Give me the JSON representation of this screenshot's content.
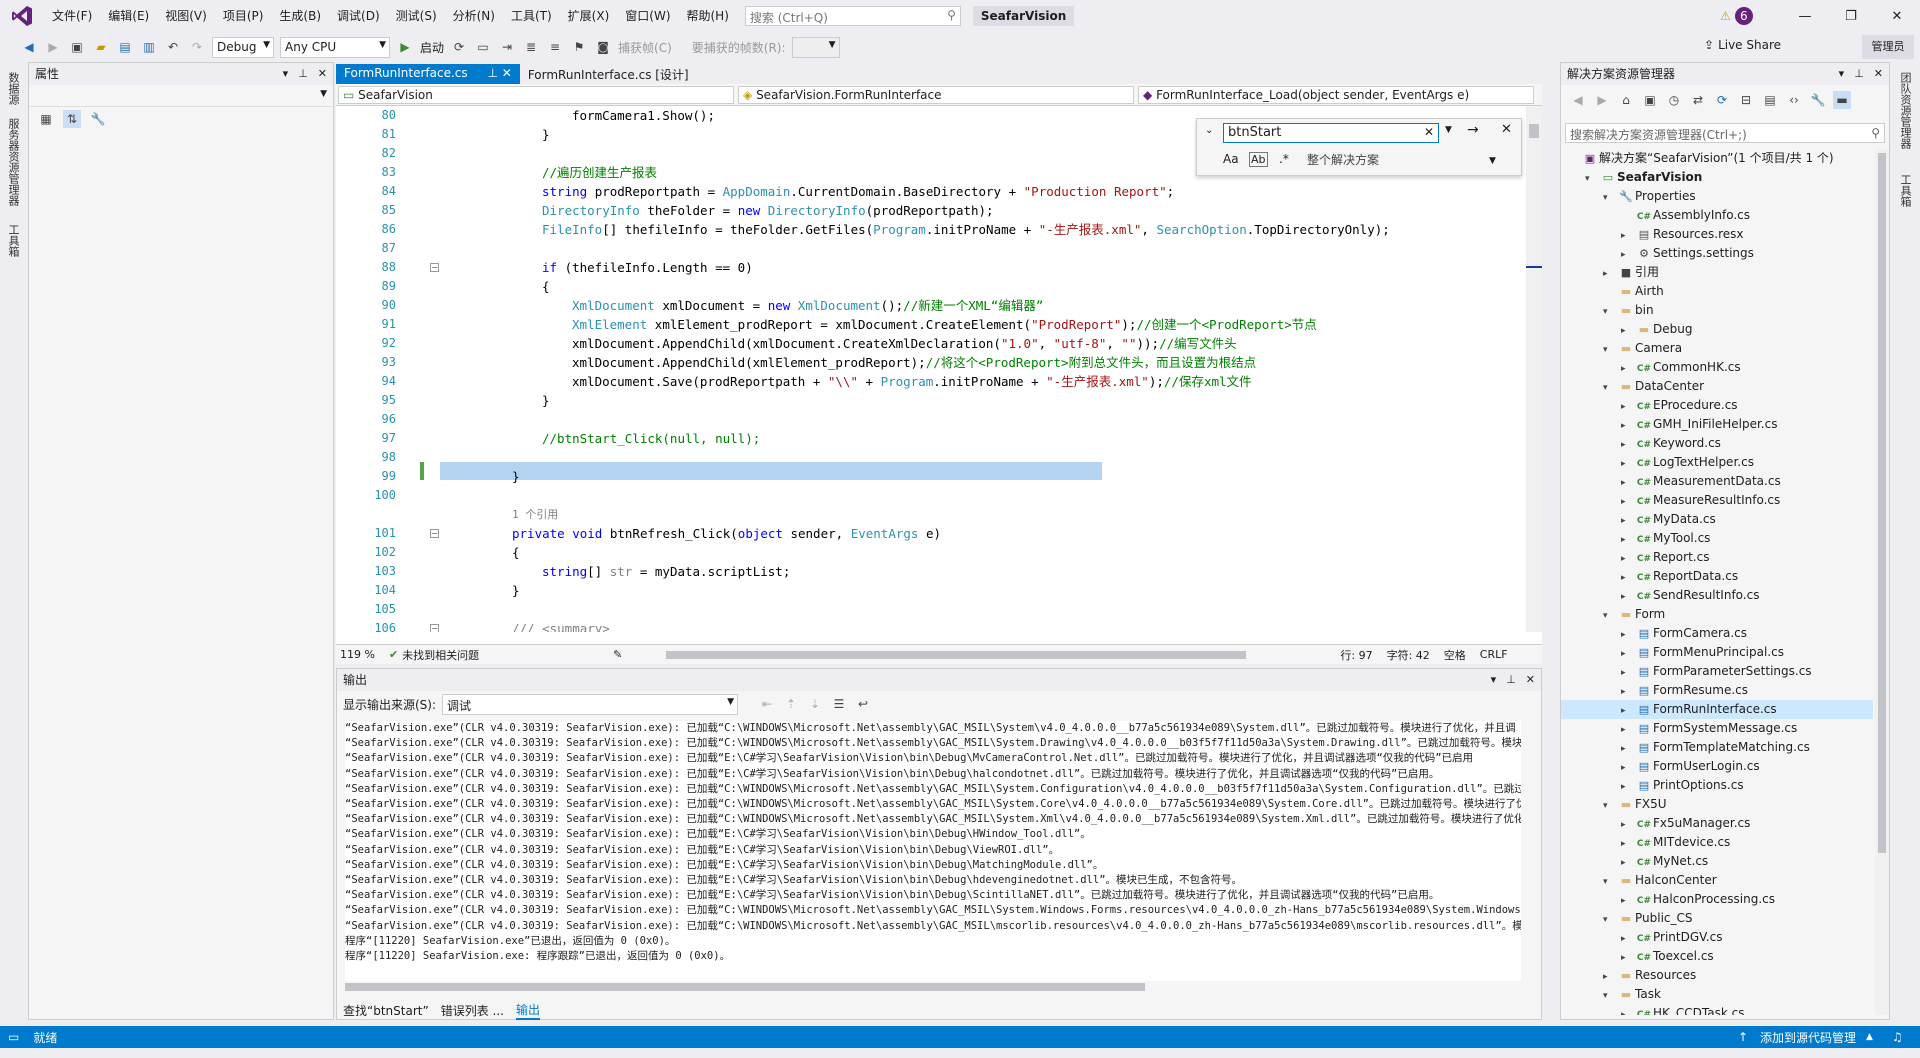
{
  "menu": [
    "文件(F)",
    "编辑(E)",
    "视图(V)",
    "项目(P)",
    "生成(B)",
    "调试(D)",
    "测试(S)",
    "分析(N)",
    "工具(T)",
    "扩展(X)",
    "窗口(W)",
    "帮助(H)"
  ],
  "search_placeholder": "搜索 (Ctrl+Q)",
  "app_title": "SeafarVision",
  "notification_count": "6",
  "toolbar": {
    "config": "Debug",
    "platform": "Any CPU",
    "start": "启动",
    "capture_frame": "捕获帧(C)",
    "frames_label": "要捕获的帧数(R):",
    "live_share": "Live Share",
    "admin": "管理员"
  },
  "left_vtabs": [
    "数据源",
    "服务器资源管理器",
    "工具箱"
  ],
  "props_title": "属性",
  "tabs": [
    {
      "label": "FormRunInterface.cs",
      "active": true
    },
    {
      "label": "FormRunInterface.cs [设计]",
      "active": false
    }
  ],
  "nav": {
    "project": "SeafarVision",
    "class": "SeafarVision.FormRunInterface",
    "member": "FormRunInterface_Load(object sender, EventArgs e)"
  },
  "find": {
    "text": "btnStart",
    "scope": "整个解决方案"
  },
  "editor_status": {
    "zoom": "119 %",
    "issues": "未找到相关问题",
    "line": "行: 97",
    "col": "字符: 42",
    "space": "空格",
    "eol": "CRLF"
  },
  "code_lines": {
    "ln80": "80",
    "ln81": "81",
    "ln82": "82",
    "ln83": "83",
    "ln84": "84",
    "ln85": "85",
    "ln86": "86",
    "ln87": "87",
    "ln88": "88",
    "ln89": "89",
    "ln90": "90",
    "ln91": "91",
    "ln92": "92",
    "ln93": "93",
    "ln94": "94",
    "ln95": "95",
    "ln96": "96",
    "ln97": "97",
    "ln98": "98",
    "ln99": "99",
    "ln100": "100",
    "ln101": "101",
    "ln102": "102",
    "ln103": "103",
    "ln104": "104",
    "ln105": "105",
    "ln106": "106"
  },
  "code": {
    "l80": "formCamera1.Show();",
    "l81": "}",
    "l83": "//遍历创建生产报表",
    "l84a": "string ",
    "l84b": "prodReportpath = ",
    "l84c": "AppDomain",
    ".l84d": "",
    "l84e": ".CurrentDomain.BaseDirectory + ",
    "l84f": "\"Production Report\"",
    ";": ";",
    "l85a": "DirectoryInfo",
    "l85b": " theFolder = ",
    "l85c": "new ",
    "l85d": "DirectoryInfo",
    "l85e": "(prodReportpath);",
    "l86a": "FileInfo",
    "l86b": "[] thefileInfo = theFolder.GetFiles(",
    "l86c": "Program",
    "l86d": ".initProName + ",
    "l86e": "\"-生产报表.xml\"",
    "l86f": ", ",
    "l86g": "SearchOption",
    "l86h": ".TopDirectoryOnly);",
    "l88a": "if ",
    "l88b": "(thefileInfo.Length == 0)",
    "l89": "{",
    "l90a": "XmlDocument",
    "l90b": " xmlDocument = ",
    "l90c": "new ",
    "l90d": "XmlDocument",
    "l90e": "();",
    "l90f": "//新建一个XML“编辑器”",
    "l91a": "XmlElement",
    "l91b": " xmlElement_prodReport = xmlDocument.CreateElement(",
    "l91c": "\"ProdReport\"",
    "l91d": ");",
    "l91e": "//创建一个<ProdReport>节点",
    "l92a": "xmlDocument.AppendChild(xmlDocument.CreateXmlDeclaration(",
    "l92b": "\"1.0\"",
    ",": ", ",
    "l92c": "\"utf-8\"",
    "l92d": "\"\"",
    "l92e": "));",
    "l92f": "//编写文件头",
    "l93a": "xmlDocument.AppendChild(xmlElement_prodReport);",
    "l93b": "//将这个<ProdReport>附到总文件头，而且设置为根结点",
    "l94a": "xmlDocument.Save(prodReportpath + ",
    "l94b": "\"\\\\\"",
    "l94c": " + ",
    "l94d": "Program",
    "l94e": ".initProName + ",
    "l94f": "\"-生产报表.xml\"",
    "l94g": ");",
    "l94h": "//保存xml文件",
    "l95": "}",
    "l97": "//btnStart_Click(null, null);",
    "l99": "}",
    "ref": "1 个引用",
    "l101a": "private ",
    "l101b": "void ",
    "l101c": "btnRefresh_Click(",
    "l101d": "object ",
    "l101e": "sender, ",
    "l101f": "EventArgs",
    "l101g": " e)",
    "l102": "{",
    "l103a": "string",
    "l103b": "[] ",
    "l103c": "str",
    " l103d": " = myData.scriptList;",
    "l104": "}",
    "l106": "/// <summary>"
  },
  "output": {
    "title": "输出",
    "source_label": "显示输出来源(S):",
    "source": "调试",
    "lines": [
      "“SeafarVision.exe”(CLR v4.0.30319: SeafarVision.exe): 已加载“C:\\WINDOWS\\Microsoft.Net\\assembly\\GAC_MSIL\\System\\v4.0_4.0.0.0__b77a5c561934e089\\System.dll”。已跳过加载符号。模块进行了优化，并且调",
      "“SeafarVision.exe”(CLR v4.0.30319: SeafarVision.exe): 已加载“C:\\WINDOWS\\Microsoft.Net\\assembly\\GAC_MSIL\\System.Drawing\\v4.0_4.0.0.0__b03f5f7f11d50a3a\\System.Drawing.dll”。已跳过加载符号。模块进",
      "“SeafarVision.exe”(CLR v4.0.30319: SeafarVision.exe): 已加载“E:\\C#学习\\SeafarVision\\Vision\\bin\\Debug\\MvCameraControl.Net.dll”。已跳过加载符号。模块进行了优化，并且调试器选项“仅我的代码”已启用",
      "“SeafarVision.exe”(CLR v4.0.30319: SeafarVision.exe): 已加载“E:\\C#学习\\SeafarVision\\Vision\\bin\\Debug\\halcondotnet.dll”。已跳过加载符号。模块进行了优化，并且调试器选项“仅我的代码”已启用。",
      "“SeafarVision.exe”(CLR v4.0.30319: SeafarVision.exe): 已加载“C:\\WINDOWS\\Microsoft.Net\\assembly\\GAC_MSIL\\System.Configuration\\v4.0_4.0.0.0__b03f5f7f11d50a3a\\System.Configuration.dll”。已跳过加载",
      "“SeafarVision.exe”(CLR v4.0.30319: SeafarVision.exe): 已加载“C:\\WINDOWS\\Microsoft.Net\\assembly\\GAC_MSIL\\System.Core\\v4.0_4.0.0.0__b77a5c561934e089\\System.Core.dll”。已跳过加载符号。模块进行了优化",
      "“SeafarVision.exe”(CLR v4.0.30319: SeafarVision.exe): 已加载“C:\\WINDOWS\\Microsoft.Net\\assembly\\GAC_MSIL\\System.Xml\\v4.0_4.0.0.0__b77a5c561934e089\\System.Xml.dll”。已跳过加载符号。模块进行了优化",
      "“SeafarVision.exe”(CLR v4.0.30319: SeafarVision.exe): 已加载“E:\\C#学习\\SeafarVision\\Vision\\bin\\Debug\\HWindow_Tool.dll”。",
      "“SeafarVision.exe”(CLR v4.0.30319: SeafarVision.exe): 已加载“E:\\C#学习\\SeafarVision\\Vision\\bin\\Debug\\ViewROI.dll”。",
      "“SeafarVision.exe”(CLR v4.0.30319: SeafarVision.exe): 已加载“E:\\C#学习\\SeafarVision\\Vision\\bin\\Debug\\MatchingModule.dll”。",
      "“SeafarVision.exe”(CLR v4.0.30319: SeafarVision.exe): 已加载“E:\\C#学习\\SeafarVision\\Vision\\bin\\Debug\\hdevenginedotnet.dll”。模块已生成，不包含符号。",
      "“SeafarVision.exe”(CLR v4.0.30319: SeafarVision.exe): 已加载“E:\\C#学习\\SeafarVision\\Vision\\bin\\Debug\\ScintillaNET.dll”。已跳过加载符号。模块进行了优化，并且调试器选项“仅我的代码”已启用。",
      "“SeafarVision.exe”(CLR v4.0.30319: SeafarVision.exe): 已加载“C:\\WINDOWS\\Microsoft.Net\\assembly\\GAC_MSIL\\System.Windows.Forms.resources\\v4.0_4.0.0.0_zh-Hans_b77a5c561934e089\\System.Windows.Forms.r",
      "“SeafarVision.exe”(CLR v4.0.30319: SeafarVision.exe): 已加载“C:\\WINDOWS\\Microsoft.Net\\assembly\\GAC_MSIL\\mscorlib.resources\\v4.0_4.0.0.0_zh-Hans_b77a5c561934e089\\mscorlib.resources.dll”。模块已生",
      "程序“[11220] SeafarVision.exe”已退出，返回值为 0 (0x0)。",
      "程序“[11220] SeafarVision.exe: 程序跟踪”已退出，返回值为 0 (0x0)。"
    ],
    "tabs": [
      "查找“btnStart”",
      "错误列表 ...",
      "输出"
    ]
  },
  "solution": {
    "title": "解决方案资源管理器",
    "search_placeholder": "搜索解决方案资源管理器(Ctrl+;)",
    "items": [
      {
        "label": "解决方案“SeafarVision”(1 个项目/共 1 个)",
        "icon": "solution-icon"
      },
      {
        "label": "SeafarVision",
        "icon": "project-icon"
      },
      {
        "label": "Properties",
        "icon": "wrench-icon"
      },
      {
        "label": "AssemblyInfo.cs",
        "icon": "csharp-icon"
      },
      {
        "label": "Resources.resx",
        "icon": "file-icon"
      },
      {
        "label": "Settings.settings",
        "icon": "gear-icon"
      },
      {
        "label": "引用",
        "icon": "reference-icon"
      },
      {
        "label": "Airth",
        "icon": "folder-icon"
      },
      {
        "label": "bin",
        "icon": "folder-icon"
      },
      {
        "label": "Debug",
        "icon": "folder-icon"
      },
      {
        "label": "Camera",
        "icon": "folder-icon"
      },
      {
        "label": "CommonHK.cs",
        "icon": "csharp-icon"
      },
      {
        "label": "DataCenter",
        "icon": "folder-icon"
      },
      {
        "label": "EProcedure.cs",
        "icon": "csharp-icon"
      },
      {
        "label": "GMH_IniFileHelper.cs",
        "icon": "csharp-icon"
      },
      {
        "label": "Keyword.cs",
        "icon": "csharp-icon"
      },
      {
        "label": "LogTextHelper.cs",
        "icon": "csharp-icon"
      },
      {
        "label": "MeasurementData.cs",
        "icon": "csharp-icon"
      },
      {
        "label": "MeasureResultInfo.cs",
        "icon": "csharp-icon"
      },
      {
        "label": "MyData.cs",
        "icon": "csharp-icon"
      },
      {
        "label": "MyTool.cs",
        "icon": "csharp-icon"
      },
      {
        "label": "Report.cs",
        "icon": "csharp-icon"
      },
      {
        "label": "ReportData.cs",
        "icon": "csharp-icon"
      },
      {
        "label": "SendResultInfo.cs",
        "icon": "csharp-icon"
      },
      {
        "label": "Form",
        "icon": "folder-icon"
      },
      {
        "label": "FormCamera.cs",
        "icon": "form-icon"
      },
      {
        "label": "FormMenuPrincipal.cs",
        "icon": "form-icon"
      },
      {
        "label": "FormParameterSettings.cs",
        "icon": "form-icon"
      },
      {
        "label": "FormResume.cs",
        "icon": "form-icon"
      },
      {
        "label": "FormRunInterface.cs",
        "icon": "form-icon"
      },
      {
        "label": "FormSystemMessage.cs",
        "icon": "form-icon"
      },
      {
        "label": "FormTemplateMatching.cs",
        "icon": "form-icon"
      },
      {
        "label": "FormUserLogin.cs",
        "icon": "form-icon"
      },
      {
        "label": "PrintOptions.cs",
        "icon": "form-icon"
      },
      {
        "label": "FX5U",
        "icon": "folder-icon"
      },
      {
        "label": "Fx5uManager.cs",
        "icon": "csharp-icon"
      },
      {
        "label": "MITdevice.cs",
        "icon": "csharp-icon"
      },
      {
        "label": "MyNet.cs",
        "icon": "csharp-icon"
      },
      {
        "label": "HalconCenter",
        "icon": "folder-icon"
      },
      {
        "label": "HalconProcessing.cs",
        "icon": "csharp-icon"
      },
      {
        "label": "Public_CS",
        "icon": "folder-icon"
      },
      {
        "label": "PrintDGV.cs",
        "icon": "csharp-icon"
      },
      {
        "label": "Toexcel.cs",
        "icon": "csharp-icon"
      },
      {
        "label": "Resources",
        "icon": "folder-icon"
      },
      {
        "label": "Task",
        "icon": "folder-icon"
      },
      {
        "label": "HK_CCDTask.cs",
        "icon": "csharp-icon"
      }
    ]
  },
  "right_vtabs": [
    "团队资源管理器",
    "工具箱"
  ],
  "statusbar": {
    "ready": "就绪",
    "source_control": "添加到源代码管理"
  }
}
